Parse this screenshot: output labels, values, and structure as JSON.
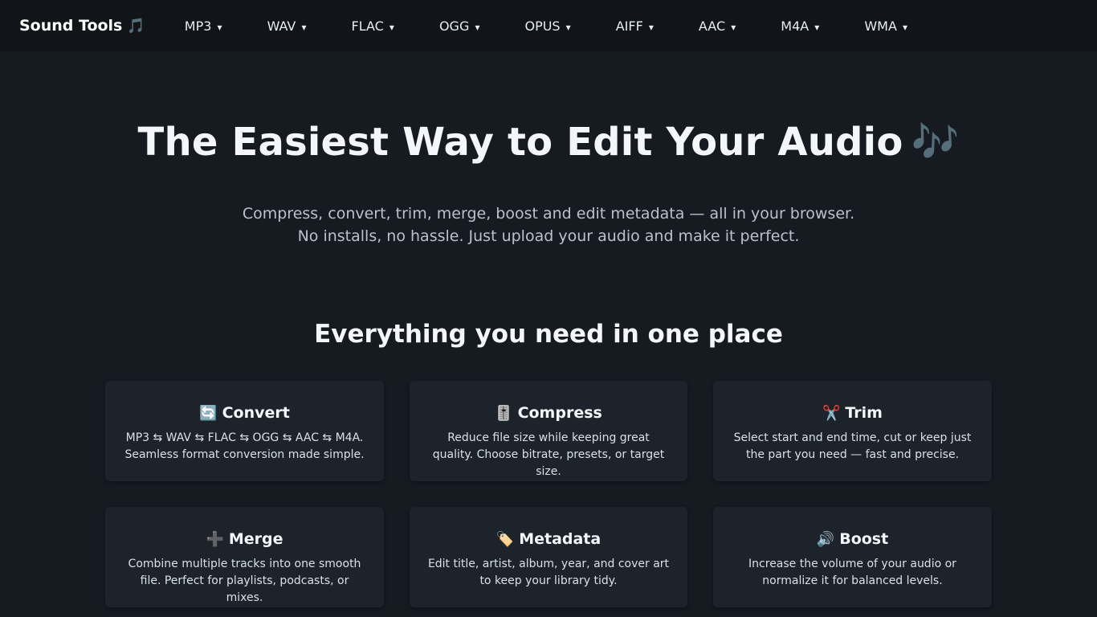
{
  "nav": {
    "brand": "Sound Tools",
    "brand_icon": "🎵",
    "items": [
      {
        "label": "MP3",
        "caret": "▾"
      },
      {
        "label": "WAV",
        "caret": "▾"
      },
      {
        "label": "FLAC",
        "caret": "▾"
      },
      {
        "label": "OGG",
        "caret": "▾"
      },
      {
        "label": "OPUS",
        "caret": "▾"
      },
      {
        "label": "AIFF",
        "caret": "▾"
      },
      {
        "label": "AAC",
        "caret": "▾"
      },
      {
        "label": "M4A",
        "caret": "▾"
      },
      {
        "label": "WMA",
        "caret": "▾"
      }
    ]
  },
  "hero": {
    "title": "The Easiest Way to Edit Your Audio",
    "title_icon": "🎶",
    "subtitle_line1": "Compress, convert, trim, merge, boost and edit metadata — all in your browser.",
    "subtitle_line2": "No installs, no hassle. Just upload your audio and make it perfect."
  },
  "features": {
    "heading": "Everything you need in one place",
    "cards": [
      {
        "icon": "🔄",
        "icon_name": "convert-icon",
        "title": "Convert",
        "desc": "MP3 ⇆ WAV ⇆ FLAC ⇆ OGG ⇆ AAC ⇆ M4A. Seamless format conversion made simple."
      },
      {
        "icon": "🎚️",
        "icon_name": "slider-icon",
        "title": "Compress",
        "desc": "Reduce file size while keeping great quality. Choose bitrate, presets, or target size."
      },
      {
        "icon": "✂️",
        "icon_name": "scissors-icon",
        "title": "Trim",
        "desc": "Select start and end time, cut or keep just the part you need — fast and precise."
      },
      {
        "icon": "➕",
        "icon_name": "plus-icon",
        "title": "Merge",
        "desc": "Combine multiple tracks into one smooth file. Perfect for playlists, podcasts, or mixes."
      },
      {
        "icon": "🏷️",
        "icon_name": "tag-icon",
        "title": "Metadata",
        "desc": "Edit title, artist, album, year, and cover art to keep your library tidy."
      },
      {
        "icon": "🔊",
        "icon_name": "speaker-icon",
        "title": "Boost",
        "desc": "Increase the volume of your audio or normalize it for balanced levels."
      }
    ]
  }
}
